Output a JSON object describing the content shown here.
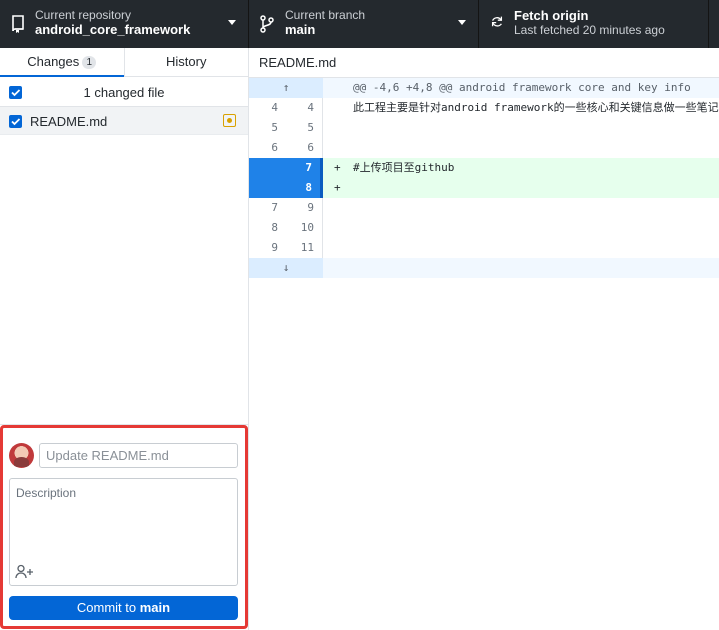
{
  "toolbar": {
    "repo_caption": "Current repository",
    "repo_name": "android_core_framework",
    "branch_caption": "Current branch",
    "branch_name": "main",
    "fetch_title": "Fetch origin",
    "fetch_subtitle": "Last fetched 20 minutes ago"
  },
  "tabs": {
    "changes_label": "Changes",
    "changes_count": "1",
    "history_label": "History"
  },
  "changes": {
    "header_label": "1 changed file",
    "files": [
      {
        "name": "README.md",
        "status": "modified"
      }
    ]
  },
  "commit": {
    "summary_placeholder": "Update README.md",
    "description_placeholder": "Description",
    "button_prefix": "Commit to",
    "button_branch": "main"
  },
  "diff": {
    "file_name": "README.md",
    "hunk_header": "@@ -4,6 +4,8 @@ android framework core and key info",
    "expand_up_glyph": "↑",
    "expand_down_glyph": "↓",
    "lines": [
      {
        "old": "4",
        "new": "4",
        "prefix": "",
        "text": "此工程主要是针对android framework的一些核心和关键信息做一些笔记。"
      },
      {
        "old": "5",
        "new": "5",
        "prefix": "",
        "text": ""
      },
      {
        "old": "6",
        "new": "6",
        "prefix": "",
        "text": ""
      },
      {
        "old": "",
        "new": "7",
        "prefix": "+",
        "text": "#上传项目至github"
      },
      {
        "old": "",
        "new": "8",
        "prefix": "+",
        "text": ""
      },
      {
        "old": "7",
        "new": "9",
        "prefix": "",
        "text": ""
      },
      {
        "old": "8",
        "new": "10",
        "prefix": "",
        "text": ""
      },
      {
        "old": "9",
        "new": "11",
        "prefix": "",
        "text": ""
      }
    ]
  },
  "colors": {
    "accent": "#0366d6",
    "toolbar_bg": "#24292e",
    "added_line_bg": "#e6ffed",
    "highlight_border": "#e53935"
  }
}
